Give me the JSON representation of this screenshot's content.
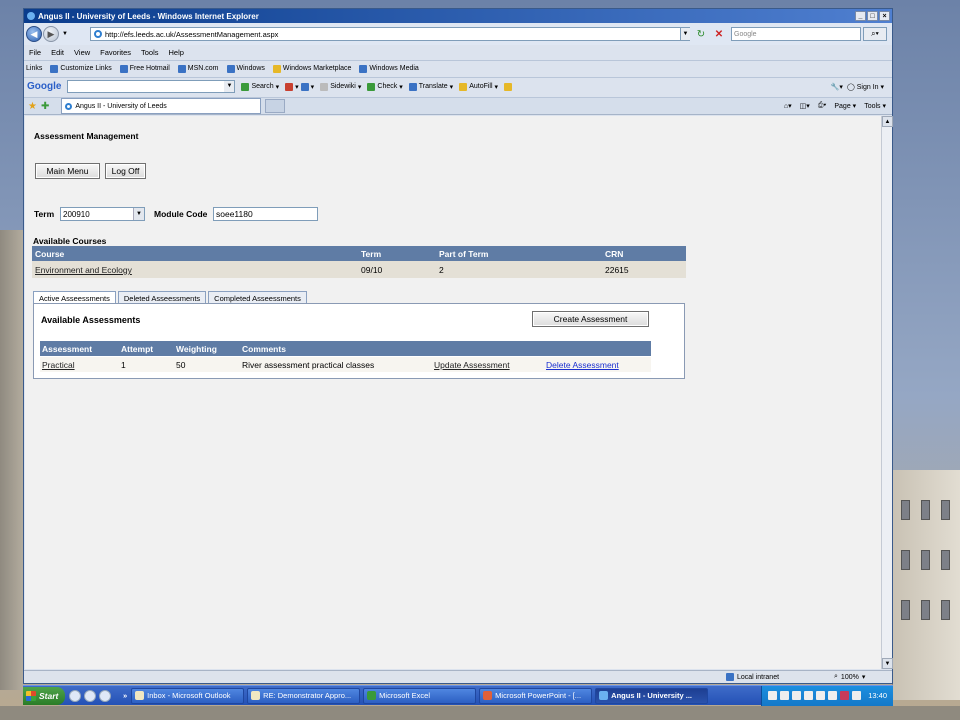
{
  "window": {
    "title": "Angus II - University of Leeds - Windows Internet Explorer",
    "controls": [
      "_",
      "□",
      "×"
    ]
  },
  "address_bar": {
    "url": "http://efs.leeds.ac.uk/AssessmentManagement.aspx",
    "search_placeholder": "Google"
  },
  "menu": [
    "File",
    "Edit",
    "View",
    "Favorites",
    "Tools",
    "Help"
  ],
  "links_bar": {
    "label": "Links",
    "items": [
      "Customize Links",
      "Free Hotmail",
      "MSN.com",
      "Windows",
      "Windows Marketplace",
      "Windows Media"
    ]
  },
  "google_toolbar": {
    "logo": "Google",
    "buttons": [
      "Search",
      "Sidewiki",
      "Check",
      "Translate",
      "AutoFill"
    ],
    "sign_in": "Sign In"
  },
  "tab": {
    "title": "Angus II - University of Leeds"
  },
  "command_bar": [
    "Page",
    "Tools"
  ],
  "page": {
    "title": "Assessment Management",
    "main_menu_button": "Main Menu",
    "log_off_button": "Log Off",
    "term_label": "Term",
    "term_value": "200910",
    "module_code_label": "Module Code",
    "module_code_value": "soee1180",
    "available_courses_label": "Available Courses",
    "courses_table": {
      "headers": [
        "Course",
        "Term",
        "Part of Term",
        "CRN"
      ],
      "rows": [
        [
          "Environment and Ecology",
          "09/10",
          "2",
          "22615"
        ]
      ]
    },
    "tabs": [
      "Active Asseessments",
      "Deleted Asseessments",
      "Completed Asseessments"
    ],
    "panel_title": "Available Assessments",
    "create_button": "Create Assessment",
    "assessments_table": {
      "headers": [
        "Assessment",
        "Attempt",
        "Weighting",
        "Comments"
      ],
      "rows": [
        {
          "assessment": "Practical",
          "attempt": "1",
          "weighting": "50",
          "comments": "River assessment practical classes",
          "update": "Update Assessment",
          "delete": "Delete Assessment"
        }
      ]
    }
  },
  "status_bar": {
    "zone": "Local intranet",
    "zoom": "100%"
  },
  "taskbar": {
    "start": "Start",
    "buttons": [
      "Inbox - Microsoft Outlook",
      "RE: Demonstrator Appro...",
      "Microsoft Excel",
      "Microsoft PowerPoint - [...",
      "Angus II - University ..."
    ],
    "clock": "13:40"
  },
  "colors": {
    "table_header": "#5f7ca5",
    "course_row": "#e4e0d6",
    "delete_link": "#1a2fd0",
    "taskbar": "#2451b5"
  }
}
